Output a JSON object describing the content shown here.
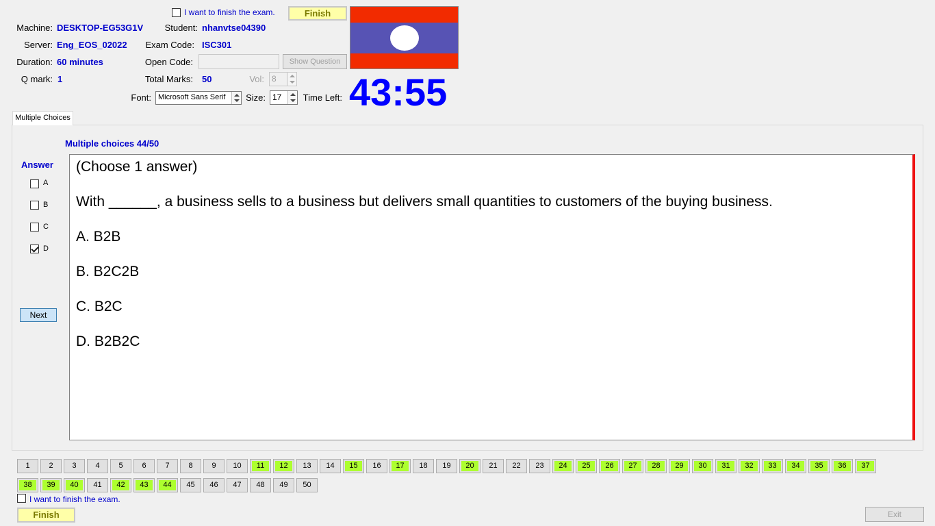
{
  "header": {
    "finish_check_label": "I want to finish the exam.",
    "finish_button": "Finish",
    "machine_label": "Machine:",
    "machine_value": "DESKTOP-EG53G1V",
    "student_label": "Student:",
    "student_value": "nhanvtse04390",
    "server_label": "Server:",
    "server_value": "Eng_EOS_02022",
    "exam_code_label": "Exam Code:",
    "exam_code_value": "ISC301",
    "duration_label": "Duration:",
    "duration_value": "60 minutes",
    "open_code_label": "Open Code:",
    "open_code_value": "",
    "show_question_button": "Show Question",
    "qmark_label": "Q mark:",
    "qmark_value": "1",
    "total_marks_label": "Total Marks:",
    "total_marks_value": "50",
    "vol_label": "Vol:",
    "vol_value": "8",
    "font_label": "Font:",
    "font_value": "Microsoft Sans Serif",
    "size_label": "Size:",
    "size_value": "17",
    "time_left_label": "Time Left:",
    "time_left_value": "43:55",
    "flag_colors": {
      "red": "#f22b00",
      "blue": "#5753b4",
      "white": "#ffffff"
    }
  },
  "tab": {
    "label": "Multiple Choices"
  },
  "question": {
    "progress": "Multiple choices 44/50",
    "instruction": "(Choose 1 answer)",
    "stem": "With ______, a business sells to a business but delivers small quantities to customers of the buying business.",
    "options": [
      "A.  B2B",
      "B.  B2C2B",
      "C.  B2C",
      "D.  B2B2C"
    ]
  },
  "answer": {
    "title": "Answer",
    "choices": [
      {
        "letter": "A",
        "checked": false
      },
      {
        "letter": "B",
        "checked": false
      },
      {
        "letter": "C",
        "checked": false
      },
      {
        "letter": "D",
        "checked": true
      }
    ],
    "next_button": "Next"
  },
  "nav": {
    "row1": [
      "1",
      "2",
      "3",
      "4",
      "5",
      "6",
      "7",
      "8",
      "9",
      "10",
      "11",
      "12",
      "13",
      "14",
      "15",
      "16",
      "17",
      "18",
      "19",
      "20",
      "21",
      "22",
      "23",
      "24",
      "25",
      "26",
      "27",
      "28",
      "29",
      "30",
      "31",
      "32",
      "33",
      "34",
      "35",
      "36",
      "37"
    ],
    "row2": [
      "38",
      "39",
      "40",
      "41",
      "42",
      "43",
      "44",
      "45",
      "46",
      "47",
      "48",
      "49",
      "50"
    ],
    "answered": [
      "11",
      "12",
      "15",
      "17",
      "20",
      "24",
      "25",
      "26",
      "27",
      "28",
      "29",
      "30",
      "31",
      "32",
      "33",
      "34",
      "35",
      "36",
      "37",
      "38",
      "39",
      "40",
      "42",
      "43",
      "44"
    ],
    "answered_color": "#adff2f"
  },
  "footer": {
    "finish_check_label": "I want to finish the exam.",
    "finish_button": "Finish",
    "exit_button": "Exit"
  },
  "colors": {
    "accent_blue": "#0000cc",
    "timer_blue": "#0000ff",
    "finish_yellow": "#ffffa8",
    "question_border_red": "#ee1111"
  }
}
